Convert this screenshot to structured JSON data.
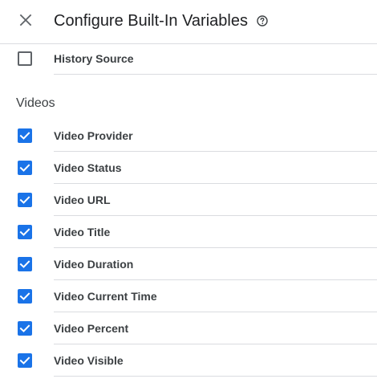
{
  "header": {
    "title": "Configure Built-In Variables",
    "close_icon": "close-icon",
    "help_icon": "help-circle-icon"
  },
  "colors": {
    "accent": "#1a73e8",
    "divider": "#dadce0",
    "text": "#202124"
  },
  "previous_item": {
    "label": "History Source",
    "checked": false
  },
  "videos": {
    "title": "Videos",
    "items": [
      {
        "label": "Video Provider",
        "checked": true
      },
      {
        "label": "Video Status",
        "checked": true
      },
      {
        "label": "Video URL",
        "checked": true
      },
      {
        "label": "Video Title",
        "checked": true
      },
      {
        "label": "Video Duration",
        "checked": true
      },
      {
        "label": "Video Current Time",
        "checked": true
      },
      {
        "label": "Video Percent",
        "checked": true
      },
      {
        "label": "Video Visible",
        "checked": true
      }
    ]
  }
}
